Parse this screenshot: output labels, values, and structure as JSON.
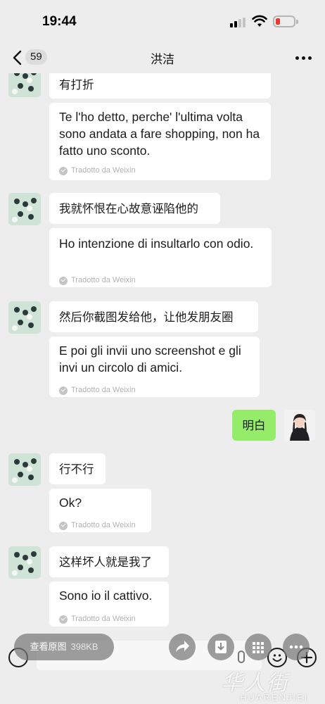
{
  "status_bar": {
    "time": "19:44"
  },
  "nav": {
    "back_count": "59",
    "title": "洪洁"
  },
  "messages": [
    {
      "zh": "有打折",
      "it": "Te l'ho detto, perche' l'ultima volta sono andata a fare shopping, non ha fatto uno sconto.",
      "note": "Tradotto da Weixin"
    },
    {
      "zh": "我就怀恨在心故意诬陷他的",
      "it": "Ho intenzione di insultarlo con odio.",
      "note": "Tradotto da Weixin"
    },
    {
      "zh": "然后你截图发给他，让他发朋友圈",
      "it": "E poi gli invii uno screenshot e gli invi un circolo di amici.",
      "note": "Tradotto da Weixin"
    },
    {
      "self": "明白"
    },
    {
      "zh": "行不行",
      "it": "Ok?",
      "note": "Tradotto da Weixin"
    },
    {
      "zh": "这样坏人就是我了",
      "it": "Sono io il cattivo.",
      "note": "Tradotto da Weixin"
    }
  ],
  "image_viewer": {
    "view_original": "查看原图",
    "size": "398KB"
  },
  "watermark": {
    "cn": "华人街",
    "en": "HUARENJIEI"
  },
  "colors": {
    "sent_bubble": "#95ec69",
    "received_bubble": "#ffffff",
    "background": "#ededed"
  }
}
